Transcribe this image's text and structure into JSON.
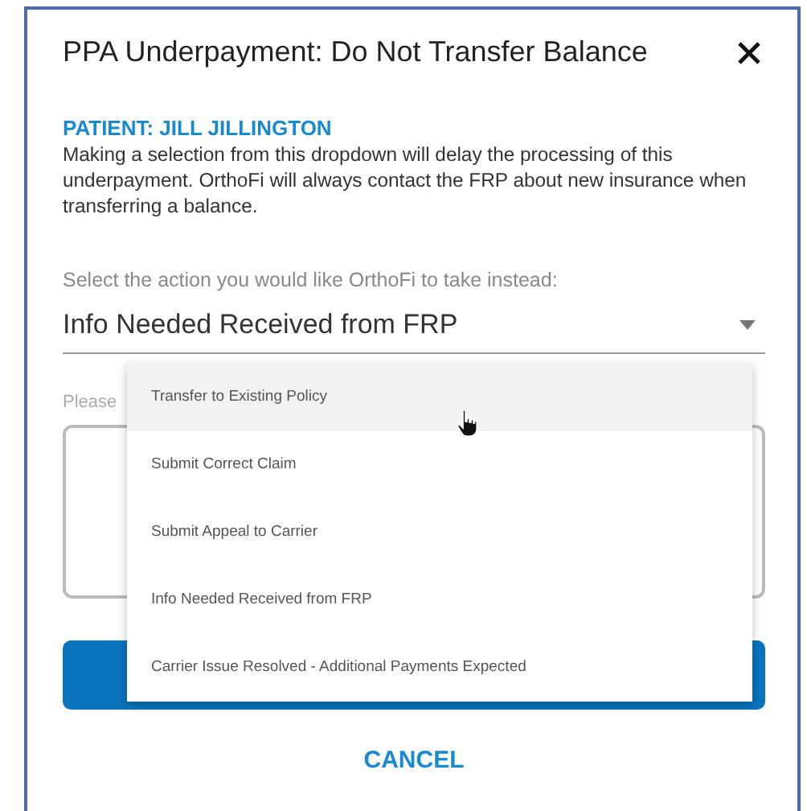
{
  "dialog": {
    "title": "PPA Underpayment: Do Not Transfer Balance",
    "patient": "PATIENT: JILL JILLINGTON",
    "message": "Making a selection from this dropdown will delay the processing of this underpayment. OrthoFi will always contact the FRP about new insurance when transferring a balance.",
    "select": {
      "label": "Select the action you would like OrthoFi to take instead:",
      "value": "Info Needed Received from FRP",
      "expanded": true
    },
    "options": [
      {
        "label": "Transfer to Existing Policy",
        "hovered": true
      },
      {
        "label": "Submit Correct Claim",
        "hovered": false
      },
      {
        "label": "Submit Appeal to Carrier",
        "hovered": false
      },
      {
        "label": "Info Needed Received from FRP",
        "hovered": false
      },
      {
        "label": "Carrier Issue Resolved - Additional Payments Expected",
        "hovered": false
      }
    ],
    "note_label": "Please",
    "cancel": "CANCEL"
  }
}
